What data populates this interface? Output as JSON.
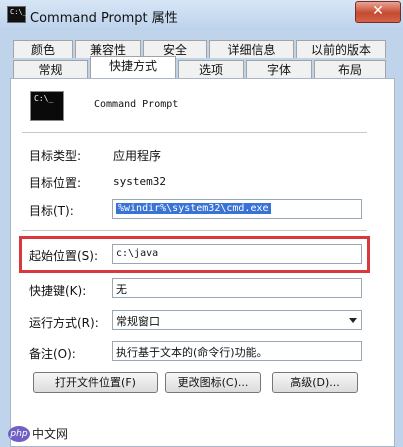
{
  "window": {
    "title": "Command Prompt 属性",
    "icon_text": "C:\\_",
    "close_symbol": "✕"
  },
  "tabs_back": [
    "颜色",
    "兼容性",
    "安全",
    "详细信息",
    "以前的版本"
  ],
  "tabs_front": [
    "常规",
    "快捷方式",
    "选项",
    "字体",
    "布局"
  ],
  "active_tab": "快捷方式",
  "shortcut": {
    "icon_text": "C:\\_",
    "name": "Command Prompt",
    "target_type_label": "目标类型:",
    "target_type_value": "应用程序",
    "target_location_label": "目标位置:",
    "target_location_value": "system32",
    "target_label": "目标(T):",
    "target_value": "%windir%\\system32\\cmd.exe",
    "start_in_label": "起始位置(S):",
    "start_in_value": "c:\\java",
    "hotkey_label": "快捷键(K):",
    "hotkey_value": "无",
    "run_label": "运行方式(R):",
    "run_value": "常规窗口",
    "comment_label": "备注(O):",
    "comment_value": "执行基于文本的(命令行)功能。"
  },
  "buttons": {
    "open_location": "打开文件位置(F)",
    "change_icon": "更改图标(C)...",
    "advanced": "高级(D)..."
  },
  "watermark": {
    "logo": "php",
    "text": "中文网"
  },
  "colors": {
    "highlight_box": "#d9393c",
    "selection": "#3a73d6",
    "titlebar": "#bcd2ec",
    "close_button": "#c44a31"
  }
}
